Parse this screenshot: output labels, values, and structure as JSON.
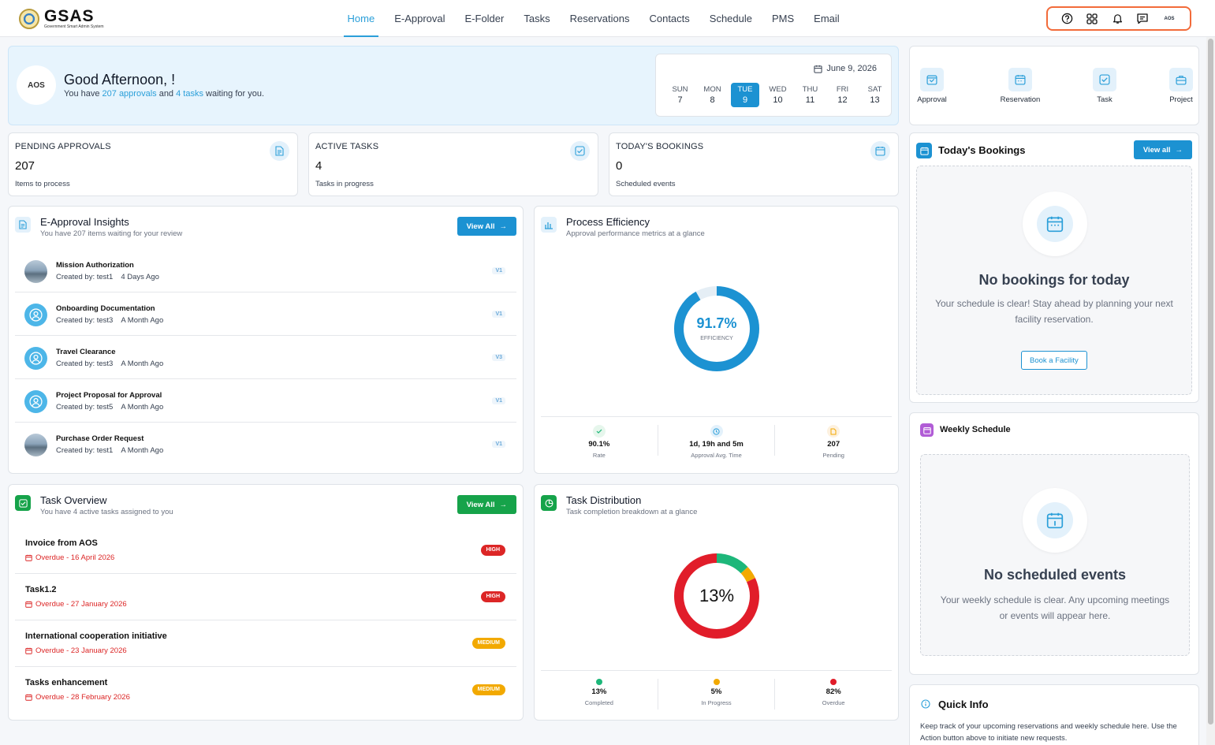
{
  "app": {
    "logo_title": "GSAS",
    "logo_subtitle": "Government Smart Admin System"
  },
  "nav": [
    {
      "label": "Home",
      "active": true
    },
    {
      "label": "E-Approval"
    },
    {
      "label": "E-Folder"
    },
    {
      "label": "Tasks"
    },
    {
      "label": "Reservations"
    },
    {
      "label": "Contacts"
    },
    {
      "label": "Schedule"
    },
    {
      "label": "PMS"
    },
    {
      "label": "Email"
    }
  ],
  "toolbar": {
    "avatar_text": "AOS"
  },
  "welcome": {
    "avatar_text": "AOS",
    "greeting": "Good Afternoon, !",
    "sub_prefix": "You have ",
    "approvals": "207 approvals",
    "sub_mid": " and ",
    "tasks": "4 tasks",
    "sub_suffix": " waiting for you."
  },
  "calendar": {
    "date": "June 9, 2026",
    "days": [
      {
        "name": "SUN",
        "num": "7"
      },
      {
        "name": "MON",
        "num": "8"
      },
      {
        "name": "TUE",
        "num": "9",
        "active": true
      },
      {
        "name": "WED",
        "num": "10"
      },
      {
        "name": "THU",
        "num": "11"
      },
      {
        "name": "FRI",
        "num": "12"
      },
      {
        "name": "SAT",
        "num": "13"
      }
    ]
  },
  "stats": [
    {
      "label": "PENDING APPROVALS",
      "value": "207",
      "desc": "Items to process",
      "icon": "document-icon"
    },
    {
      "label": "ACTIVE TASKS",
      "value": "4",
      "desc": "Tasks in progress",
      "icon": "checkbox-icon"
    },
    {
      "label": "TODAY'S BOOKINGS",
      "value": "0",
      "desc": "Scheduled events",
      "icon": "calendar-icon"
    }
  ],
  "approvals": {
    "title": "E-Approval Insights",
    "subtitle": "You have 207 items waiting for your review",
    "view_all": "View All",
    "items": [
      {
        "title": "Mission Authorization",
        "creator": "Created by: test1",
        "time": "4 Days Ago",
        "version": "V1",
        "avatar": "photo"
      },
      {
        "title": "Onboarding Documentation",
        "creator": "Created by: test3",
        "time": "A Month Ago",
        "version": "V1",
        "avatar": "user"
      },
      {
        "title": "Travel Clearance",
        "creator": "Created by: test3",
        "time": "A Month Ago",
        "version": "V3",
        "avatar": "user"
      },
      {
        "title": "Project Proposal for Approval",
        "creator": "Created by: test5",
        "time": "A Month Ago",
        "version": "V1",
        "avatar": "user"
      },
      {
        "title": "Purchase Order Request",
        "creator": "Created by: test1",
        "time": "A Month Ago",
        "version": "V1",
        "avatar": "photo"
      }
    ]
  },
  "efficiency": {
    "title": "Process Efficiency",
    "subtitle": "Approval performance metrics at a glance",
    "value_text": "91.7%",
    "value": 91.7,
    "label": "EFFICIENCY",
    "color": "#1c92d2",
    "metrics": [
      {
        "value": "90.1%",
        "label": "Rate",
        "color": "#e6f6ec"
      },
      {
        "value": "1d, 19h and 5m",
        "label": "Approval Avg. Time",
        "color": "#e3f1fb"
      },
      {
        "value": "207",
        "label": "Pending",
        "color": "#fdf1df"
      }
    ]
  },
  "tasks": {
    "title": "Task Overview",
    "subtitle": "You have 4 active tasks assigned to you",
    "view_all": "View All",
    "items": [
      {
        "title": "Invoice from AOS",
        "due": "Overdue - 16 April 2026",
        "priority": "HIGH",
        "level": "high"
      },
      {
        "title": "Task1.2",
        "due": "Overdue - 27 January 2026",
        "priority": "HIGH",
        "level": "high"
      },
      {
        "title": "International cooperation initiative",
        "due": "Overdue - 23 January 2026",
        "priority": "MEDIUM",
        "level": "medium"
      },
      {
        "title": "Tasks enhancement",
        "due": "Overdue - 28 February 2026",
        "priority": "MEDIUM",
        "level": "medium"
      }
    ]
  },
  "distribution": {
    "title": "Task Distribution",
    "subtitle": "Task completion breakdown at a glance",
    "center_text": "13%",
    "segments": [
      {
        "name": "Completed",
        "value": 13,
        "value_text": "13%",
        "color": "#1db77a"
      },
      {
        "name": "In Progress",
        "value": 5,
        "value_text": "5%",
        "color": "#f2a900"
      },
      {
        "name": "Overdue",
        "value": 82,
        "value_text": "82%",
        "color": "#e11d2a"
      }
    ]
  },
  "quick_actions": [
    {
      "label": "Approval",
      "icon": "approval-icon"
    },
    {
      "label": "Reservation",
      "icon": "reservation-icon"
    },
    {
      "label": "Task",
      "icon": "task-icon"
    },
    {
      "label": "Project",
      "icon": "briefcase-icon"
    }
  ],
  "bookings": {
    "title": "Today's Bookings",
    "view_all": "View all",
    "empty_title": "No bookings for today",
    "empty_text": "Your schedule is clear! Stay ahead by planning your next facility reservation.",
    "button": "Book a Facility"
  },
  "weekly": {
    "title": "Weekly Schedule",
    "empty_title": "No scheduled events",
    "empty_text": "Your weekly schedule is clear. Any upcoming meetings or events will appear here."
  },
  "quick_info": {
    "title": "Quick Info",
    "text": "Keep track of your upcoming reservations and weekly schedule here. Use the Action button above to initiate new requests."
  },
  "colors": {
    "accent": "#1c92d2",
    "green": "#16a34a",
    "high": "#dc2626",
    "medium": "#f2a900",
    "highlight_border": "#f26b3a"
  }
}
